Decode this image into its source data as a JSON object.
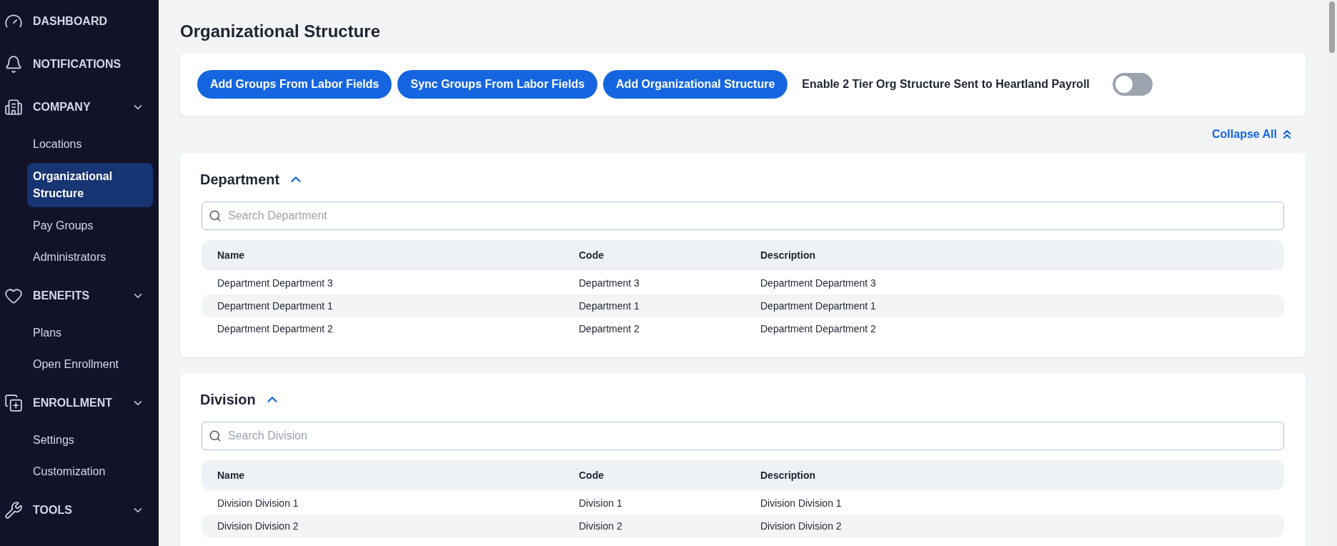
{
  "sidebar": {
    "items": [
      {
        "label": "DASHBOARD",
        "kind": "link"
      },
      {
        "label": "NOTIFICATIONS",
        "kind": "link"
      },
      {
        "label": "COMPANY",
        "kind": "group",
        "children": [
          {
            "label": "Locations",
            "selected": false
          },
          {
            "label": "Organizational Structure",
            "selected": true
          },
          {
            "label": "Pay Groups",
            "selected": false
          },
          {
            "label": "Administrators",
            "selected": false
          }
        ]
      },
      {
        "label": "BENEFITS",
        "kind": "group",
        "children": [
          {
            "label": "Plans",
            "selected": false
          },
          {
            "label": "Open Enrollment",
            "selected": false
          }
        ]
      },
      {
        "label": "ENROLLMENT",
        "kind": "group",
        "children": [
          {
            "label": "Settings",
            "selected": false
          },
          {
            "label": "Customization",
            "selected": false
          }
        ]
      },
      {
        "label": "TOOLS",
        "kind": "group"
      }
    ]
  },
  "page_title": "Organizational Structure",
  "toolbar": {
    "buttons": [
      "Add Groups From Labor Fields",
      "Sync Groups From Labor Fields",
      "Add Organizational Structure"
    ],
    "toggle": {
      "label": "Enable 2 Tier Org Structure Sent to Heartland Payroll",
      "on": false
    }
  },
  "collapse_all": "Collapse All",
  "sections": [
    {
      "title": "Department",
      "expanded": true,
      "search_placeholder": "Search Department",
      "columns": [
        "Name",
        "Code",
        "Description"
      ],
      "rows": [
        [
          "Department Department 3",
          "Department 3",
          "Department Department 3"
        ],
        [
          "Department Department 1",
          "Department 1",
          "Department Department 1"
        ],
        [
          "Department Department 2",
          "Department 2",
          "Department Department 2"
        ]
      ]
    },
    {
      "title": "Division",
      "expanded": true,
      "search_placeholder": "Search Division",
      "columns": [
        "Name",
        "Code",
        "Description"
      ],
      "rows": [
        [
          "Division Division 1",
          "Division 1",
          "Division Division 1"
        ],
        [
          "Division Division 2",
          "Division 2",
          "Division Division 2"
        ]
      ]
    }
  ]
}
